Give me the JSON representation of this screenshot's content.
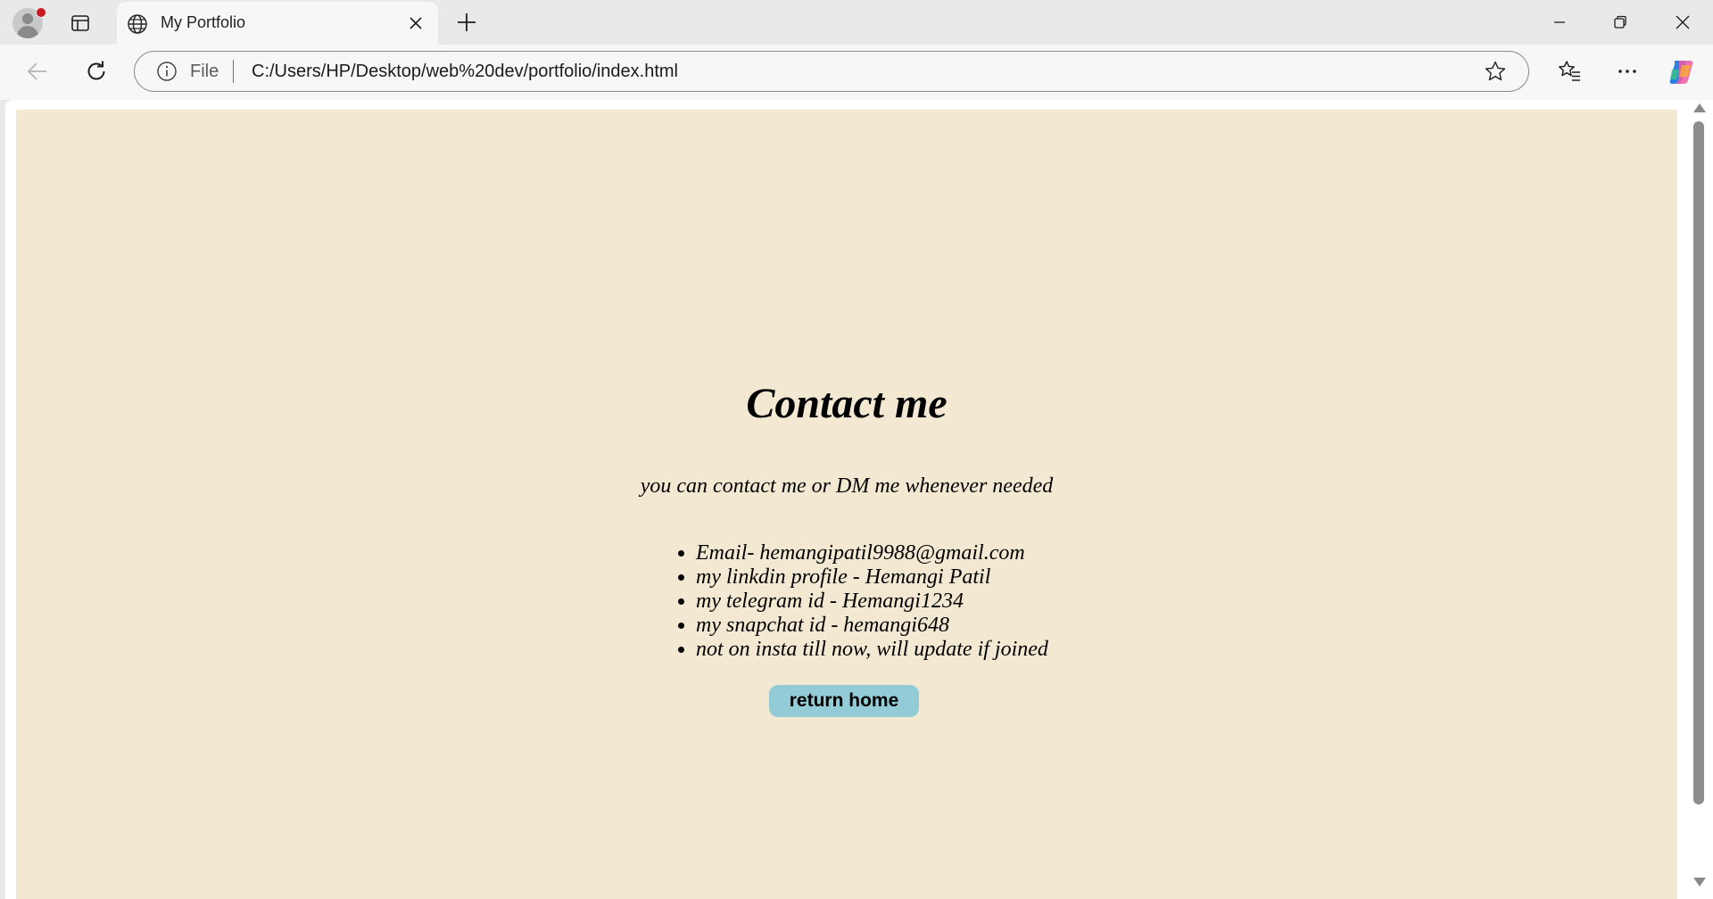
{
  "browser": {
    "tab": {
      "title": "My Portfolio",
      "icon": "globe-icon"
    },
    "address_bar": {
      "scheme_label": "File",
      "url": "C:/Users/HP/Desktop/web%20dev/portfolio/index.html"
    }
  },
  "page": {
    "background_color": "#f3e9d2",
    "heading": "Contact me",
    "subtitle": "you can contact me or DM me whenever needed",
    "contacts": [
      "Email- hemangipatil9988@gmail.com",
      "my linkdin profile - Hemangi Patil",
      "my telegram id - Hemangi1234",
      "my snapchat id - hemangi648",
      "not on insta till now, will update if joined"
    ],
    "home_button": {
      "label": "return home",
      "color": "#93cbd6"
    }
  }
}
